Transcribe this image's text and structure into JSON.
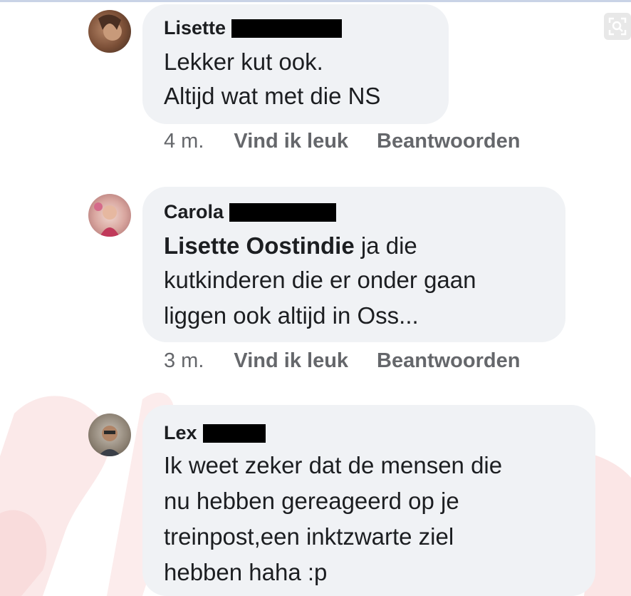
{
  "comments": [
    {
      "author": "Lisette",
      "lines": [
        "Lekker kut ook.",
        "Altijd wat met die NS"
      ],
      "time": "4 m.",
      "like": "Vind ik leuk",
      "reply": "Beantwoorden"
    },
    {
      "author": "Carola",
      "mention": "Lisette Oostindie",
      "lines": [
        " ja die",
        "kutkinderen die er onder gaan",
        "liggen ook altijd in Oss..."
      ],
      "time": "3 m.",
      "like": "Vind ik leuk",
      "reply": "Beantwoorden"
    },
    {
      "author": "Lex",
      "lines": [
        "Ik weet zeker dat de mensen die",
        "nu hebben gereageerd op je",
        "treinpost,een inktzwarte ziel",
        "hebben haha :p"
      ]
    }
  ],
  "icons": {
    "expand": "expand-icon"
  },
  "colors": {
    "bubble": "#f0f2f5",
    "text": "#1c1e21",
    "meta": "#65676b"
  }
}
